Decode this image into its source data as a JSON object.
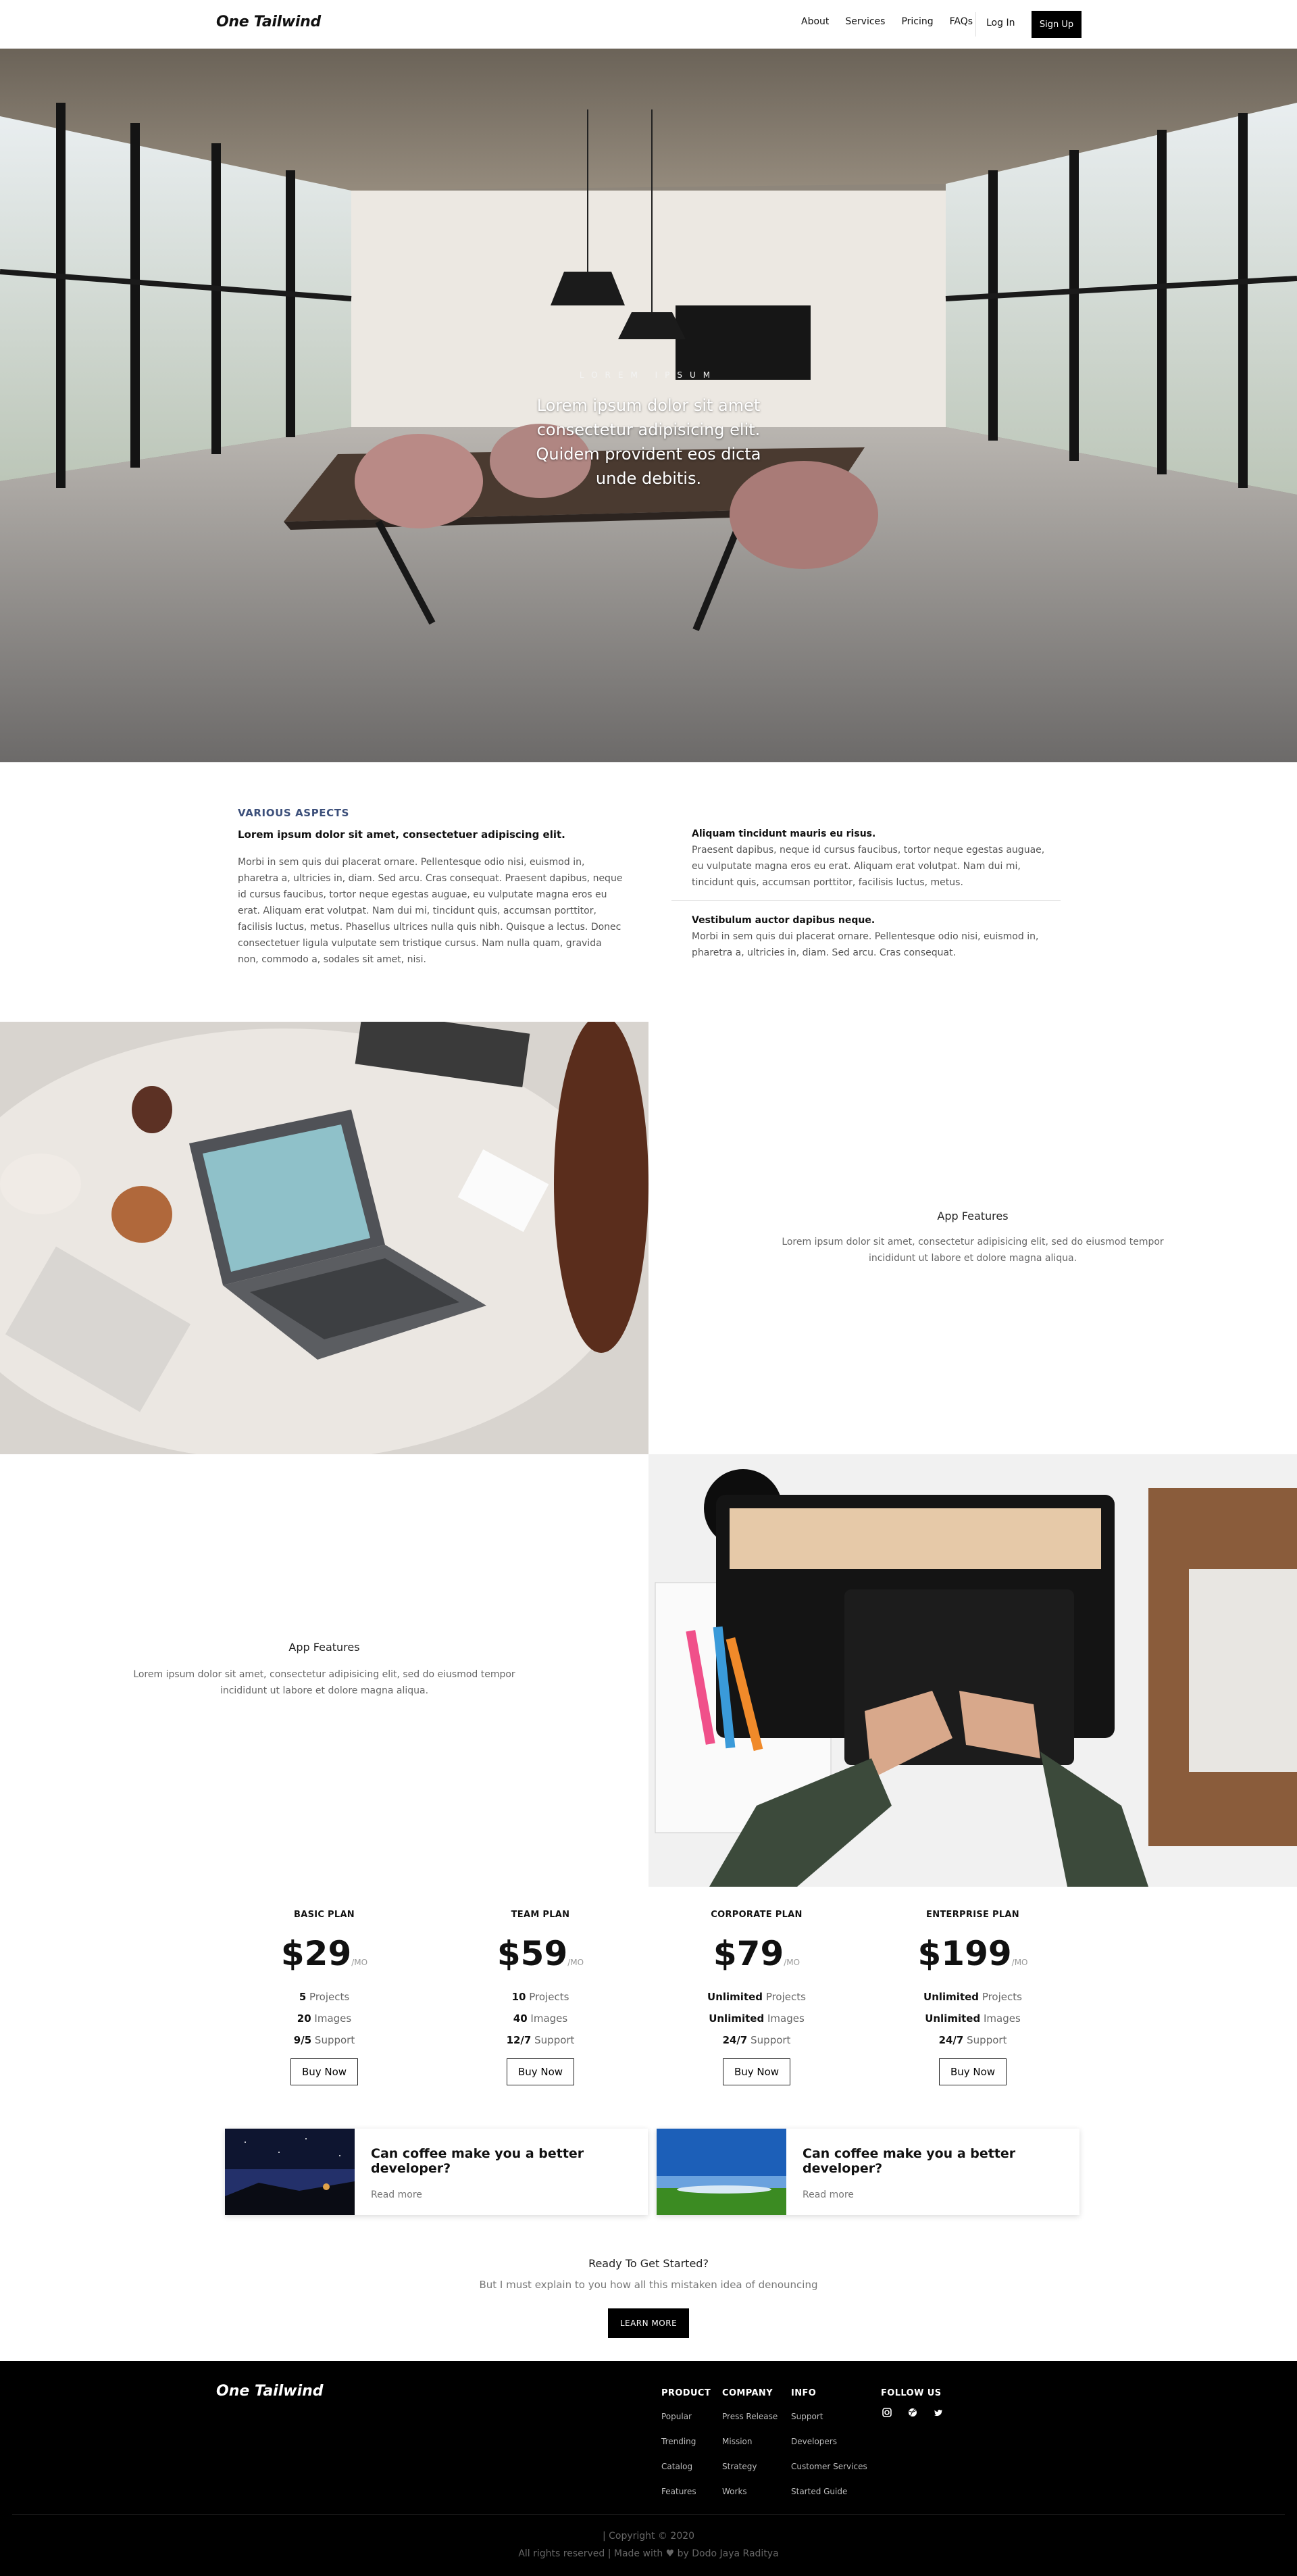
{
  "nav": {
    "brand": "One Tailwind",
    "links": [
      "About",
      "Services",
      "Pricing",
      "FAQs"
    ],
    "login": "Log In",
    "signup": "Sign Up"
  },
  "hero": {
    "kicker": "LOREM IPSUM",
    "title": "Lorem ipsum dolor sit amet consectetur adipisicing elit. Quidem provident eos dicta unde debitis."
  },
  "aspects": {
    "kicker": "VARIOUS ASPECTS",
    "lead": "Lorem ipsum dolor sit amet, consectetuer adipiscing elit.",
    "body": "Morbi in sem quis dui placerat ornare. Pellentesque odio nisi, euismod in, pharetra a, ultricies in, diam. Sed arcu. Cras consequat. Praesent dapibus, neque id cursus faucibus, tortor neque egestas auguae, eu vulputate magna eros eu erat. Aliquam erat volutpat. Nam dui mi, tincidunt quis, accumsan porttitor, facilisis luctus, metus. Phasellus ultrices nulla quis nibh. Quisque a lectus. Donec consectetuer ligula vulputate sem tristique cursus. Nam nulla quam, gravida non, commodo a, sodales sit amet, nisi.",
    "items": [
      {
        "title": "Aliquam tincidunt mauris eu risus.",
        "text": "Praesent dapibus, neque id cursus faucibus, tortor neque egestas auguae, eu vulputate magna eros eu erat. Aliquam erat volutpat. Nam dui mi, tincidunt quis, accumsan porttitor, facilisis luctus, metus."
      },
      {
        "title": "Vestibulum auctor dapibus neque.",
        "text": "Morbi in sem quis dui placerat ornare. Pellentesque odio nisi, euismod in, pharetra a, ultricies in, diam. Sed arcu. Cras consequat."
      }
    ]
  },
  "features": [
    {
      "title": "App Features",
      "text": "Lorem ipsum dolor sit amet, consectetur adipisicing elit, sed do eiusmod tempor incididunt ut labore et dolore magna aliqua."
    },
    {
      "title": "App Features",
      "text": "Lorem ipsum dolor sit amet, consectetur adipisicing elit, sed do eiusmod tempor incididunt ut labore et dolore magna aliqua."
    }
  ],
  "pricing": {
    "per": "/MO",
    "buy_label": "Buy Now",
    "plans": [
      {
        "name": "BASIC PLAN",
        "price": "$29",
        "projects": "5",
        "images": "20",
        "support": "9/5"
      },
      {
        "name": "TEAM PLAN",
        "price": "$59",
        "projects": "10",
        "images": "40",
        "support": "12/7"
      },
      {
        "name": "CORPORATE PLAN",
        "price": "$79",
        "projects": "Unlimited",
        "images": "Unlimited",
        "support": "24/7"
      },
      {
        "name": "ENTERPRISE PLAN",
        "price": "$199",
        "projects": "Unlimited",
        "images": "Unlimited",
        "support": "24/7"
      }
    ],
    "labels": {
      "projects": "Projects",
      "images": "Images",
      "support": "Support"
    }
  },
  "blog": [
    {
      "title": "Can coffee make you a better developer?",
      "link": "Read more"
    },
    {
      "title": "Can coffee make you a better developer?",
      "link": "Read more"
    }
  ],
  "cta": {
    "title": "Ready To Get Started?",
    "subtitle": "But I must explain to you how all this mistaken idea of denouncing",
    "button": "LEARN MORE"
  },
  "footer": {
    "brand": "One Tailwind",
    "columns": [
      {
        "title": "PRODUCT",
        "items": [
          "Popular",
          "Trending",
          "Catalog",
          "Features"
        ]
      },
      {
        "title": "COMPANY",
        "items": [
          "Press Release",
          "Mission",
          "Strategy",
          "Works"
        ]
      },
      {
        "title": "INFO",
        "items": [
          "Support",
          "Developers",
          "Customer Services",
          "Started Guide"
        ]
      }
    ],
    "follow_title": "FOLLOW US",
    "social_icons": [
      "instagram-icon",
      "dribbble-icon",
      "twitter-icon"
    ],
    "copyright": "| Copyright © 2020",
    "credit": "All rights reserved | Made with ♥ by Dodo Jaya Raditya"
  }
}
